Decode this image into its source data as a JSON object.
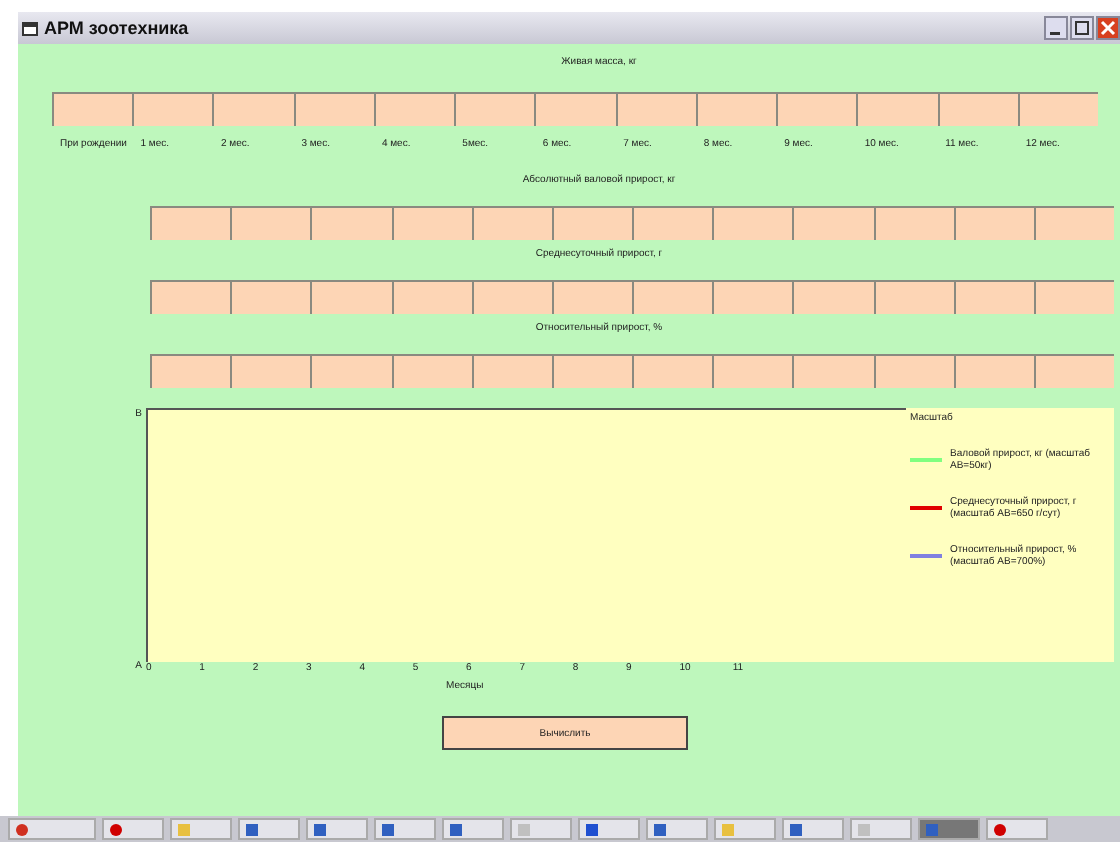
{
  "window": {
    "title": "АРМ зоотехника"
  },
  "sections": [
    {
      "title": "Живая масса, кг",
      "labelled": true
    },
    {
      "title": "Абсолютный валовой прирост, кг",
      "labelled": false
    },
    {
      "title": "Среднесуточный прирост, г",
      "labelled": false
    },
    {
      "title": "Относительный прирост, %",
      "labelled": false
    }
  ],
  "months": [
    "При рождении",
    "1 мес.",
    "2 мес.",
    "3 мес.",
    "4 мес.",
    "5мес.",
    "6 мес.",
    "7 мес.",
    "8 мес.",
    "9 мес.",
    "10 мес.",
    "11 мес.",
    "12 мес."
  ],
  "graph": {
    "y_top": "B",
    "y_bottom": "A",
    "x_ticks": [
      "0",
      "1",
      "2",
      "3",
      "4",
      "5",
      "6",
      "7",
      "8",
      "9",
      "10",
      "11"
    ],
    "x_label": "Месяцы"
  },
  "legend": {
    "title": "Масштаб",
    "items": [
      {
        "label": "Валовой прирост, кг (масштаб АВ=50кг)",
        "color": "#80ff80"
      },
      {
        "label": "Среднесуточный прирост, г (масштаб АВ=650 г/сут)",
        "color": "#e00000"
      },
      {
        "label": "Относительный прирост, % (масштаб АВ=700%)",
        "color": "#8080e0"
      }
    ]
  },
  "button": "Вычислить",
  "taskbar": [
    {
      "kind": "start"
    },
    {
      "kind": "opera"
    },
    {
      "kind": "folder"
    },
    {
      "kind": "window"
    },
    {
      "kind": "window"
    },
    {
      "kind": "window"
    },
    {
      "kind": "window"
    },
    {
      "kind": "doc"
    },
    {
      "kind": "browser"
    },
    {
      "kind": "window"
    },
    {
      "kind": "folder"
    },
    {
      "kind": "window"
    },
    {
      "kind": "doc"
    },
    {
      "kind": "active"
    },
    {
      "kind": "opera"
    }
  ]
}
